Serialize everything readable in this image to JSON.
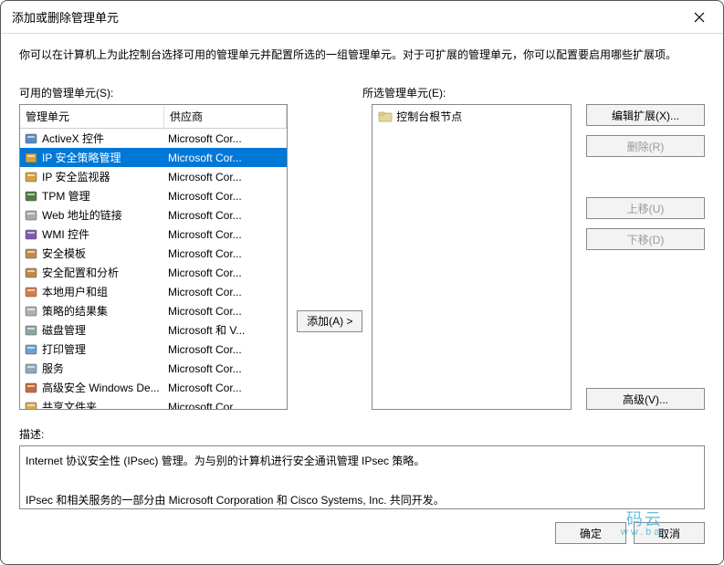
{
  "window": {
    "title": "添加或删除管理单元"
  },
  "instructions": "你可以在计算机上为此控制台选择可用的管理单元并配置所选的一组管理单元。对于可扩展的管理单元，你可以配置要启用哪些扩展项。",
  "labels": {
    "available": "可用的管理单元(S):",
    "selected": "所选管理单元(E):",
    "description": "描述:"
  },
  "columns": {
    "name": "管理单元",
    "vendor": "供应商"
  },
  "snapins": [
    {
      "name": "ActiveX 控件",
      "vendor": "Microsoft Cor...",
      "icon_color": "#5a8bc4",
      "selected": false
    },
    {
      "name": "IP 安全策略管理",
      "vendor": "Microsoft Cor...",
      "icon_color": "#d7a13b",
      "selected": true
    },
    {
      "name": "IP 安全监视器",
      "vendor": "Microsoft Cor...",
      "icon_color": "#d7a13b",
      "selected": false
    },
    {
      "name": "TPM 管理",
      "vendor": "Microsoft Cor...",
      "icon_color": "#4f7d3e",
      "selected": false
    },
    {
      "name": "Web 地址的链接",
      "vendor": "Microsoft Cor...",
      "icon_color": "#aaaaaa",
      "selected": false
    },
    {
      "name": "WMI 控件",
      "vendor": "Microsoft Cor...",
      "icon_color": "#7b5bb0",
      "selected": false
    },
    {
      "name": "安全模板",
      "vendor": "Microsoft Cor...",
      "icon_color": "#c08b4a",
      "selected": false
    },
    {
      "name": "安全配置和分析",
      "vendor": "Microsoft Cor...",
      "icon_color": "#c0884a",
      "selected": false
    },
    {
      "name": "本地用户和组",
      "vendor": "Microsoft Cor...",
      "icon_color": "#d77c4a",
      "selected": false
    },
    {
      "name": "策略的结果集",
      "vendor": "Microsoft Cor...",
      "icon_color": "#b0b0b0",
      "selected": false
    },
    {
      "name": "磁盘管理",
      "vendor": "Microsoft 和 V...",
      "icon_color": "#8aa6a6",
      "selected": false
    },
    {
      "name": "打印管理",
      "vendor": "Microsoft Cor...",
      "icon_color": "#6d9ecf",
      "selected": false
    },
    {
      "name": "服务",
      "vendor": "Microsoft Cor...",
      "icon_color": "#8fa8c2",
      "selected": false
    },
    {
      "name": "高级安全 Windows De...",
      "vendor": "Microsoft Cor...",
      "icon_color": "#c66b3a",
      "selected": false
    },
    {
      "name": "共享文件夹",
      "vendor": "Microsoft Cor...",
      "icon_color": "#d9a84c",
      "selected": false
    }
  ],
  "selected_tree": {
    "root": "控制台根节点"
  },
  "buttons": {
    "add": "添加(A) >",
    "edit_ext": "编辑扩展(X)...",
    "remove": "删除(R)",
    "move_up": "上移(U)",
    "move_down": "下移(D)",
    "advanced": "高级(V)...",
    "ok": "确定",
    "cancel": "取消"
  },
  "description_text": {
    "line1": "Internet 协议安全性 (IPsec) 管理。为与别的计算机进行安全通讯管理 IPsec 策略。",
    "line2": "IPsec 和相关服务的一部分由 Microsoft Corporation 和 Cisco Systems, Inc. 共同开发。"
  },
  "watermark": {
    "top": "码云",
    "bot": "ww.bar"
  }
}
